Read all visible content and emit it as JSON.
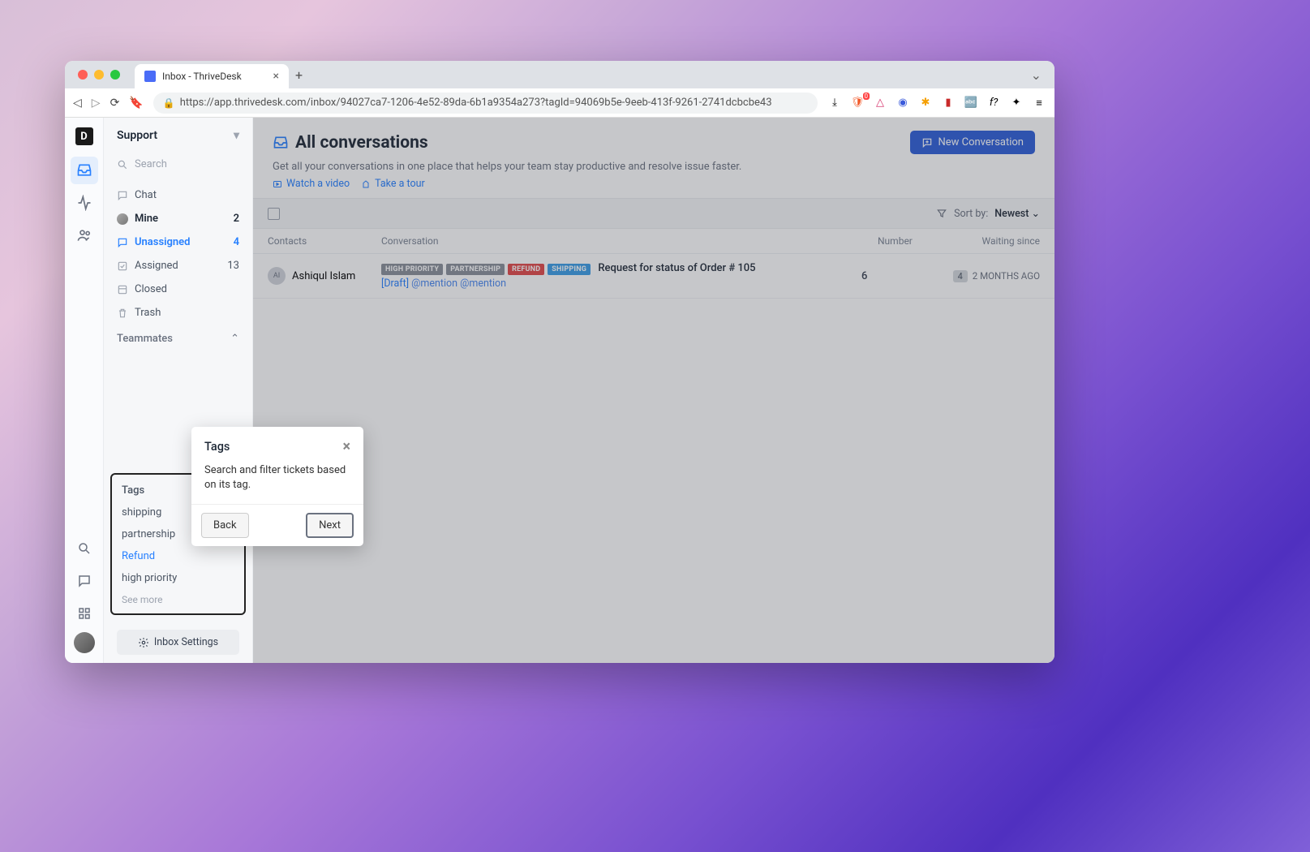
{
  "browser": {
    "tab_title": "Inbox - ThriveDesk",
    "url": "https://app.thrivedesk.com/inbox/94027ca7-1206-4e52-89da-6b1a9354a273?tagId=94069b5e-9eeb-413f-9261-2741dcbcbe43"
  },
  "sidebar": {
    "workspace": "Support",
    "search_placeholder": "Search",
    "items": [
      {
        "icon": "chat",
        "label": "Chat",
        "count": ""
      },
      {
        "icon": "avatar",
        "label": "Mine",
        "count": "2",
        "bold": true
      },
      {
        "icon": "chat",
        "label": "Unassigned",
        "count": "4",
        "active": true
      },
      {
        "icon": "check",
        "label": "Assigned",
        "count": "13"
      },
      {
        "icon": "closed",
        "label": "Closed",
        "count": ""
      },
      {
        "icon": "trash",
        "label": "Trash",
        "count": ""
      }
    ],
    "teammates_label": "Teammates",
    "tags": {
      "header": "Tags",
      "items": [
        {
          "label": "shipping"
        },
        {
          "label": "partnership"
        },
        {
          "label": "Refund",
          "active": true
        },
        {
          "label": "high priority"
        }
      ],
      "see_more": "See more"
    },
    "inbox_settings": "Inbox Settings"
  },
  "main": {
    "title": "All conversations",
    "subtitle": "Get all your conversations in one place that helps your team stay productive and resolve issue faster.",
    "watch_video": "Watch a video",
    "take_tour": "Take a tour",
    "new_conversation": "New Conversation",
    "sort_label": "Sort by:",
    "sort_value": "Newest",
    "columns": {
      "contacts": "Contacts",
      "conversation": "Conversation",
      "number": "Number",
      "waiting": "Waiting since"
    },
    "rows": [
      {
        "avatar_initials": "AI",
        "contact": "Ashiqul Islam",
        "chips": [
          {
            "label": "HIGH PRIORITY",
            "color": "#8a8f99"
          },
          {
            "label": "PARTNERSHIP",
            "color": "#8a8f99"
          },
          {
            "label": "REFUND",
            "color": "#e24848"
          },
          {
            "label": "SHIPPING",
            "color": "#3b9de6"
          }
        ],
        "subject": "Request for status of Order # 105",
        "draft_prefix": "[Draft]",
        "draft_body": "@mention @mention",
        "number": "6",
        "badge": "4",
        "waiting": "2 MONTHS AGO"
      }
    ]
  },
  "tour": {
    "title": "Tags",
    "body": "Search and filter tickets based on its tag.",
    "back": "Back",
    "next": "Next"
  }
}
